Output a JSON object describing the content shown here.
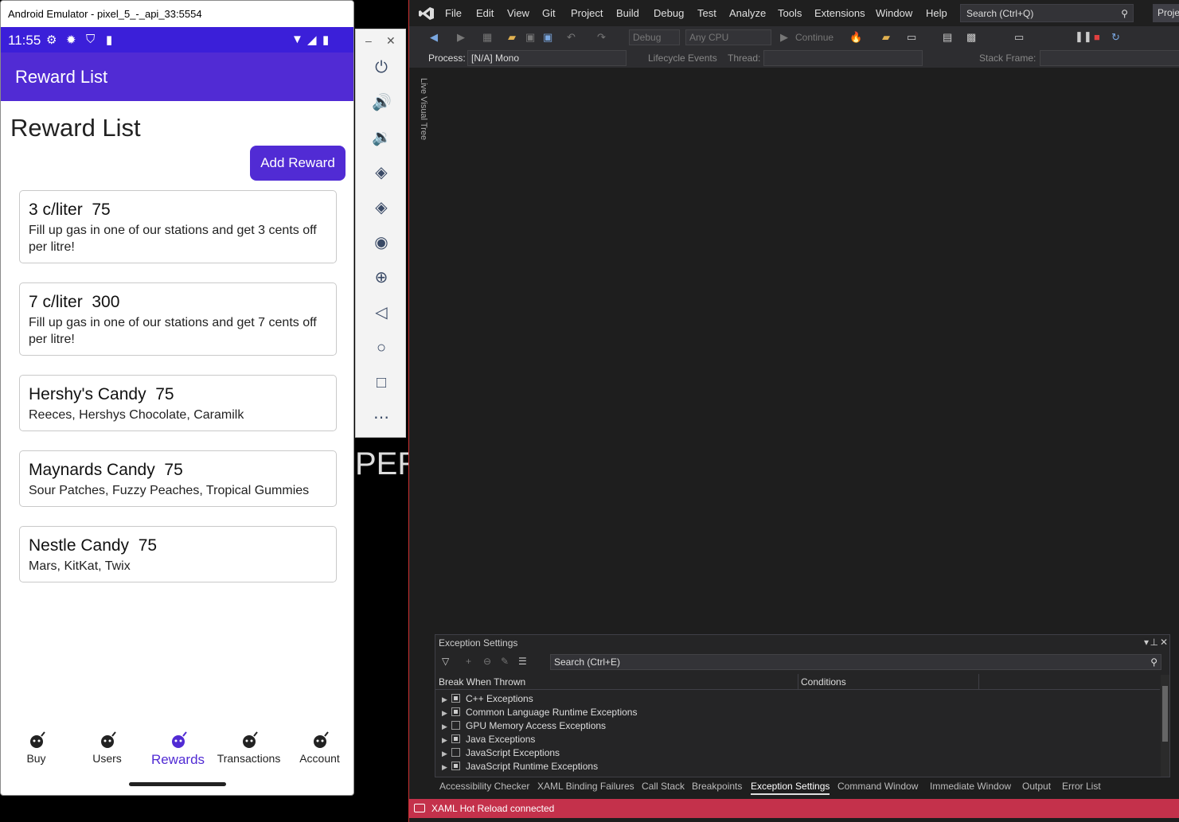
{
  "emulator": {
    "window_title": "Android Emulator - pixel_5_-_api_33:5554",
    "status_time": "11:55",
    "app_bar_title": "Reward List",
    "page_title": "Reward List",
    "add_button_label": "Add Reward",
    "rewards": [
      {
        "title": "3 c/liter  75",
        "description": "Fill up gas in one of our stations and get 3 cents off per litre!"
      },
      {
        "title": "7 c/liter  300",
        "description": "Fill up gas in one of our stations and get 7 cents off per litre!"
      },
      {
        "title": "Hershy's Candy  75",
        "description": "Reeces, Hershys Chocolate, Caramilk"
      },
      {
        "title": "Maynards Candy  75",
        "description": "Sour Patches, Fuzzy Peaches, Tropical Gummies"
      },
      {
        "title": "Nestle Candy  75",
        "description": "Mars, KitKat, Twix"
      }
    ],
    "nav": [
      {
        "label": "Buy",
        "active": false
      },
      {
        "label": "Users",
        "active": false
      },
      {
        "label": "Rewards",
        "active": true
      },
      {
        "label": "Transactions",
        "active": false
      },
      {
        "label": "Account",
        "active": false
      }
    ],
    "accent_color": "#512bd4",
    "status_color": "#3b1fd9",
    "background_text": "PER"
  },
  "vs": {
    "menu": [
      "File",
      "Edit",
      "View",
      "Git",
      "Project",
      "Build",
      "Debug",
      "Test",
      "Analyze",
      "Tools",
      "Extensions",
      "Window",
      "Help"
    ],
    "search_placeholder": "Search (Ctrl+Q)",
    "project_button": "Proje",
    "config": "Debug",
    "platform": "Any CPU",
    "continue_label": "Continue",
    "process_label": "Process:",
    "process_value": "[N/A] Mono",
    "lifecycle_label": "Lifecycle Events",
    "thread_label": "Thread:",
    "stack_frame_label": "Stack Frame:",
    "live_visual_tree": "Live Visual Tree",
    "exception_panel": {
      "title": "Exception Settings",
      "search_placeholder": "Search (Ctrl+E)",
      "col_break": "Break When Thrown",
      "col_conditions": "Conditions",
      "rows": [
        {
          "label": "C++ Exceptions",
          "checked": true
        },
        {
          "label": "Common Language Runtime Exceptions",
          "checked": true
        },
        {
          "label": "GPU Memory Access Exceptions",
          "checked": false
        },
        {
          "label": "Java Exceptions",
          "checked": true
        },
        {
          "label": "JavaScript Exceptions",
          "checked": false
        },
        {
          "label": "JavaScript Runtime Exceptions",
          "checked": true
        }
      ]
    },
    "tabs": [
      "Accessibility Checker",
      "XAML Binding Failures",
      "Call Stack",
      "Breakpoints",
      "Exception Settings",
      "Command Window",
      "Immediate Window",
      "Output",
      "Error List"
    ],
    "active_tab": "Exception Settings",
    "status_text": "XAML Hot Reload connected",
    "status_color": "#c4314b"
  }
}
